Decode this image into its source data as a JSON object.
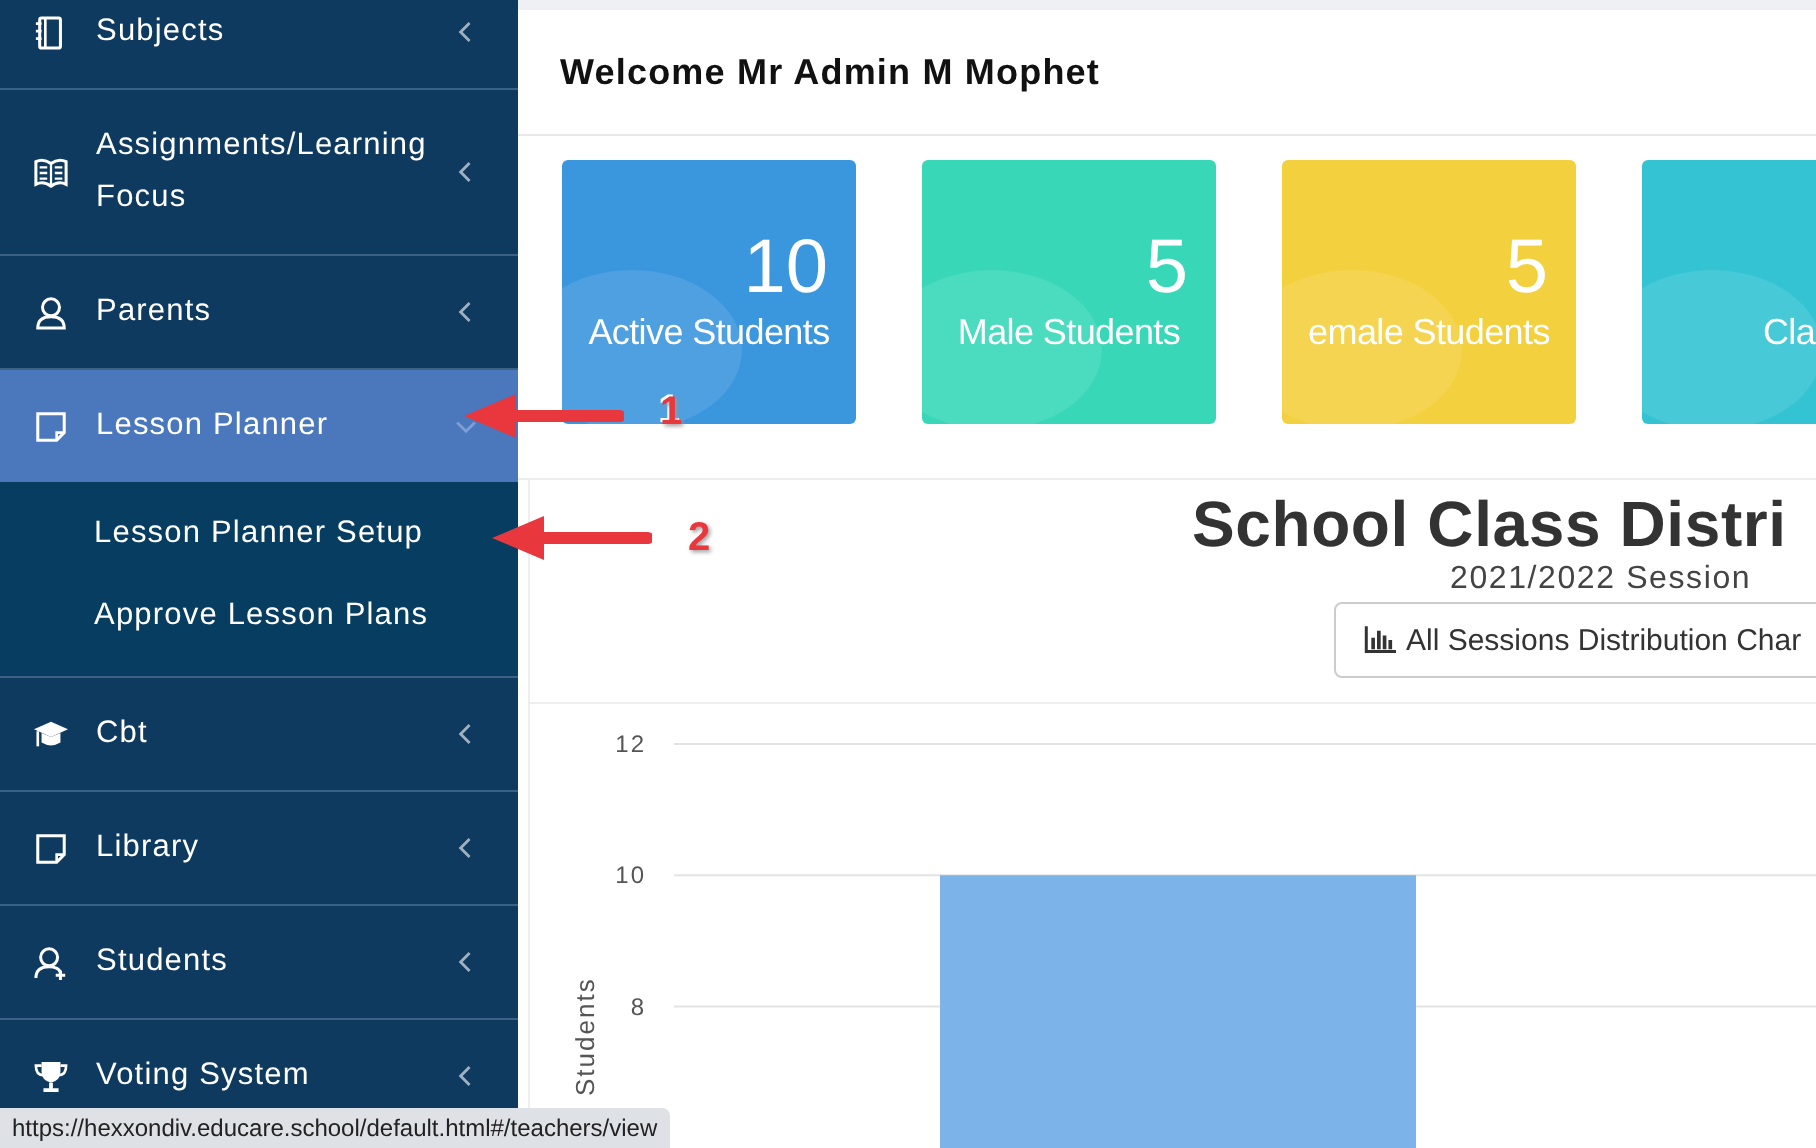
{
  "sidebar": {
    "items": [
      {
        "label": "Subjects",
        "expanded": false,
        "selected": false
      },
      {
        "label": "Assignments/Learning Focus",
        "expanded": false,
        "selected": false
      },
      {
        "label": "Parents",
        "expanded": false,
        "selected": false
      },
      {
        "label": "Lesson Planner",
        "expanded": true,
        "selected": true,
        "children": [
          {
            "label": "Lesson Planner Setup"
          },
          {
            "label": "Approve Lesson Plans"
          }
        ]
      },
      {
        "label": "Cbt",
        "expanded": false,
        "selected": false
      },
      {
        "label": "Library",
        "expanded": false,
        "selected": false
      },
      {
        "label": "Students",
        "expanded": false,
        "selected": false
      },
      {
        "label": "Voting System",
        "expanded": false,
        "selected": false
      }
    ]
  },
  "header": {
    "title": "Welcome Mr Admin M Mophet"
  },
  "stat_cards": [
    {
      "value": "10",
      "label": "Active Students",
      "color": "#3a96dd"
    },
    {
      "value": "5",
      "label": "Male Students",
      "color": "#37d7b7"
    },
    {
      "value": "5",
      "label": "emale Students",
      "color": "#f3d03e"
    },
    {
      "label": "Cla",
      "color": "#33c3d3"
    }
  ],
  "chart_panel": {
    "title": "School Class Distri",
    "subtitle": "2021/2022 Session",
    "button": "All Sessions Distribution Char",
    "chart_data": {
      "type": "bar",
      "ylabel": "Students",
      "values": [
        10
      ],
      "ylim": [
        5.6,
        12
      ],
      "yticks": [
        8,
        10,
        12
      ]
    }
  },
  "callouts": [
    {
      "label": "1"
    },
    {
      "label": "2"
    }
  ],
  "status_url": "https://hexxondiv.educare.school/default.html#/teachers/view"
}
